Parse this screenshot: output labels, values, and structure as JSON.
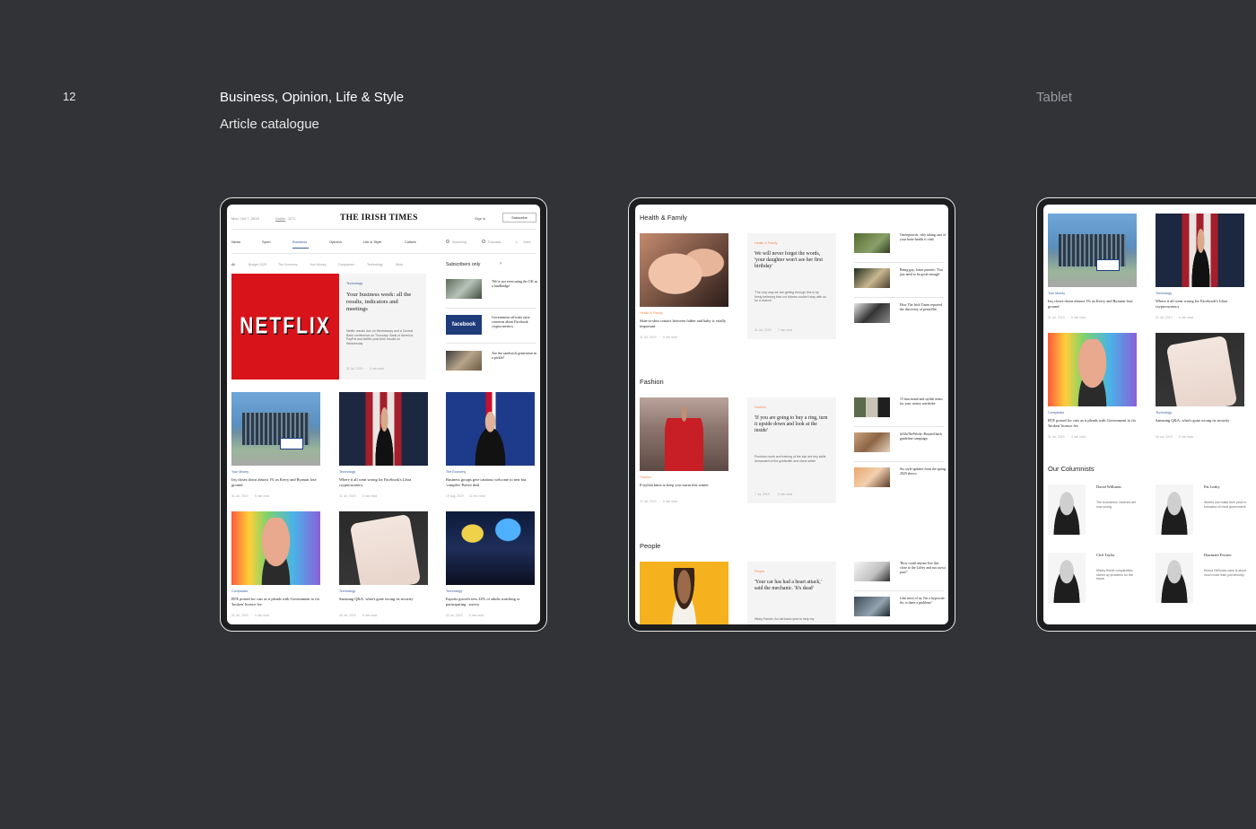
{
  "page": {
    "number": "12",
    "title": "Business, Opinion, Life & Style",
    "subtitle": "Article  catalogue",
    "device": "Tablet"
  },
  "tablet1": {
    "header": {
      "date": "Mon, Oct 7, 2019",
      "dublin_label": "Dublin",
      "temp": "11°C",
      "masthead": "THE IRISH TIMES",
      "signin": "Sign in",
      "subscribe": "Subscribe"
    },
    "nav": [
      "News",
      "Sport",
      "Business",
      "Opinion",
      "Life & Style",
      "Culture"
    ],
    "nav_tools": [
      "Searching",
      "Podcasts",
      "Video"
    ],
    "subnav": [
      "All",
      "Budget 2020",
      "The Economy",
      "Your Money",
      "Companies",
      "Technology",
      "Work"
    ],
    "featured": {
      "image": "Netflix",
      "image_text": "NETFLIX",
      "category": "Technology",
      "headline": "Your business week: all the results, indicators and meetings",
      "summary": "Netflix results due on Wednesday and a Central Bank conference on Thursday. Bank of America, PayPal and Netflix post their results on Wednesday",
      "date": "31 Jul, 2019",
      "read": "6 min read"
    },
    "subscribers_only": {
      "title": "Subscribers only",
      "arrow": "›",
      "items": [
        {
          "text": "'We're not even using the UK as a landbridge'",
          "image_text": ""
        },
        {
          "text": "Government officials raise concerns about Facebook cryptocurrency",
          "image_text": "facebook"
        },
        {
          "text": "Are the sandwich generation in a pickle?",
          "image_text": ""
        }
      ]
    },
    "grid": [
      {
        "category": "Your Money",
        "headline": "Ieq closes down almost 1% as Kerry and Ryanair lose ground",
        "date": "31 Jul, 2019",
        "read": "5 min read",
        "image_text": "KERRY"
      },
      {
        "category": "Technology",
        "headline": "Where it all went wrong for Facebook's Libra cryptocurrency",
        "date": "31 Jul, 2019",
        "read": "6 min read",
        "image_text": ""
      },
      {
        "category": "The Economy",
        "headline": "Business groups give cautious welcome to new but 'complex' Brexit deal",
        "date": "19 aug, 2019",
        "read": "11 min read",
        "image_text": ""
      },
      {
        "category": "Companies",
        "headline": "RTE poised for cuts as it pleads with Government to fix 'broken' licence fee",
        "date": "31 Jul, 2019",
        "read": "4 min read",
        "image_text": ""
      },
      {
        "category": "Technology",
        "headline": "Samsung Q&A: what's gone wrong its security",
        "date": "06 oct, 2019",
        "read": "6 min read",
        "image_text": ""
      },
      {
        "category": "Technology",
        "headline": "Esports growth sees 22% of adults watching or participating : survey",
        "date": "02 Jul, 2019",
        "read": "6 min read",
        "image_text": ""
      }
    ]
  },
  "tablet2": {
    "sections": [
      {
        "title": "Health & Family",
        "lead": {
          "category": "Health & Family",
          "headline": "Skin-to-skin contact between father and baby is vitally important",
          "date": "31 Jul, 2019",
          "read": "6 min read"
        },
        "quote": {
          "category": "Health & Family",
          "headline": "We will never forget the words, 'your daughter won't see her first birthday'",
          "summary": "'The only way we are getting through this is by firmly believing that our futures couldn't stay with us for a reason'",
          "date": "31 Jul, 2019",
          "read": "7 min read"
        },
        "side": [
          "Osteoporosis: why taking care of your bone health is vital",
          "Being gay, foster parents: 'You just need to be good enough'",
          "How The Irish Times reported the discovery of penicillin"
        ]
      },
      {
        "title": "Fashion",
        "lead": {
          "category": "Fashion",
          "headline": "8 stylish knits to keep you warm this winter",
          "date": "22 Jul, 2019",
          "read": "6 min read"
        },
        "quote": {
          "category": "Fashion",
          "headline": "'If you are going to buy a ring, turn it upside down and look at the inside'",
          "summary": "Precision work and training of the eye are key skills demanded of the goldsmith and stone setter",
          "date": "7 Jul, 2019",
          "read": "6 min read"
        },
        "side": [
          "15 functional and stylish items for your wintry wardrobe",
          "#AlloTheWittle: Rotated back guideline campaign",
          "Six style updates from the spring 2020 shows"
        ]
      },
      {
        "title": "People",
        "quote": {
          "category": "People",
          "headline": "'Your car has had a heart attack,' said the mechanic. 'It's dead'",
          "summary": "Hilary Fannin: An old basic year to help my"
        },
        "side": [
          "'How could anyone live this close to the Liffey and not own a pair?'",
          "Like most of us, I'm a hypocrite. So, is there a problem?"
        ]
      }
    ]
  },
  "tablet3": {
    "grid": [
      {
        "category": "Your Money",
        "headline": "Ieq closes down almost 1% as Kerry and Ryanair lose ground",
        "date": "31 Jul, 2019",
        "read": "5 min read",
        "image_text": "KERRY"
      },
      {
        "category": "Technology",
        "headline": "Where it all went wrong for Facebook's Libra cryptocurrency",
        "date": "31 Jul, 2019",
        "read": "6 min read"
      },
      {
        "category": "Companies",
        "headline": "RTE poised for cuts as it pleads with Government to fix 'broken' licence fee",
        "date": "31 Jul, 2019",
        "read": "4 min read"
      },
      {
        "category": "Technology",
        "headline": "Samsung Q&A: what's gone wrong its security",
        "date": "06 oct, 2019",
        "read": "6 min read"
      }
    ],
    "columnists_title": "Our Columnists",
    "columnists": [
      {
        "name": "David Williams",
        "text": "The economics I learned are now wrong"
      },
      {
        "name": "Pat Leahy",
        "text": "Streets can make their price in formation of most government"
      },
      {
        "name": "Cliff Taylor",
        "text": "Misery Brexit complexities stored up problems for the future"
      },
      {
        "name": "Diarmaid Ferriter",
        "text": "Emma DeSouza case is about much more than just security"
      }
    ]
  }
}
